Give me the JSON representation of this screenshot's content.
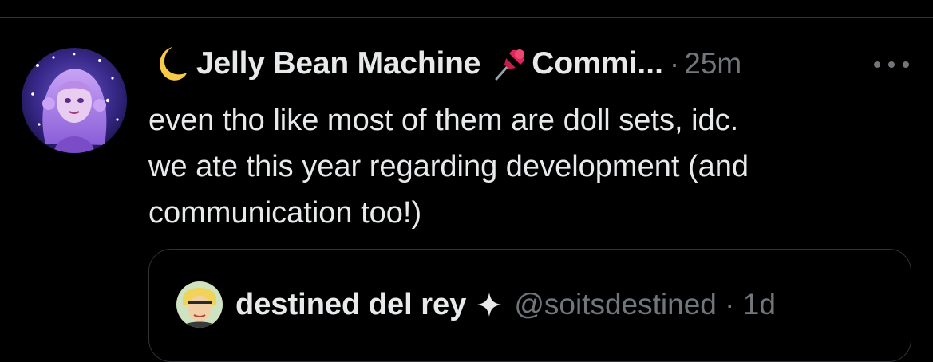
{
  "post": {
    "author": {
      "display_name": "Jelly Bean Machine",
      "name_suffix": "Commi...",
      "leading_emoji": "moon-icon",
      "inline_emoji": "pushpin-icon"
    },
    "timestamp": "25m",
    "separator": "·",
    "text_lines": [
      "even tho like most of them are doll sets, idc.",
      "we ate this year regarding development (and",
      "communication too!)"
    ]
  },
  "quoted_post": {
    "display_name": "destined del rey",
    "badge": "sparkle-icon",
    "handle": "@soitsdestined",
    "separator": "·",
    "timestamp": "1d"
  },
  "colors": {
    "background": "#000000",
    "primary_text": "#e7e9ea",
    "secondary_text": "#71767b",
    "border": "#2f3336",
    "moon": "#f7c948",
    "pin": "#e0245e"
  }
}
